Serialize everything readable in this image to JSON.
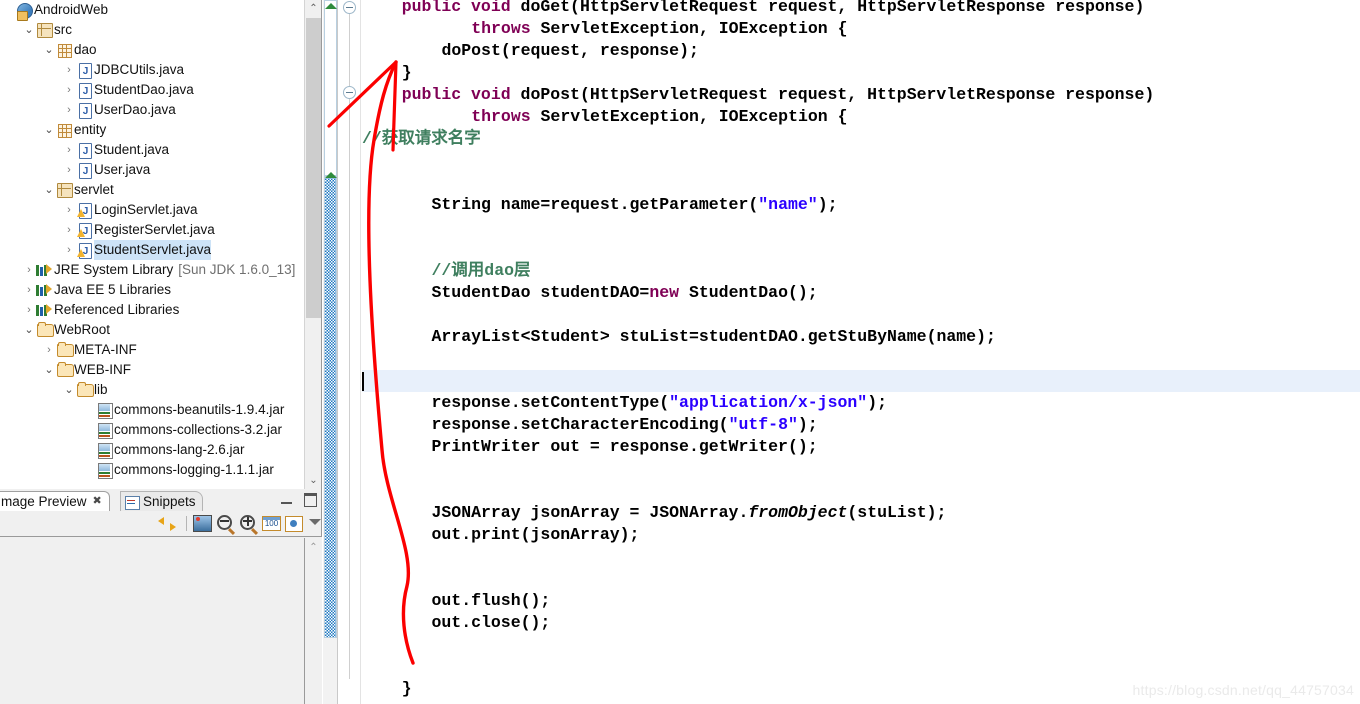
{
  "explorer": {
    "name": "package-explorer",
    "items": [
      {
        "label": "AndroidWeb",
        "suffix": "",
        "icon": "project-icon",
        "twist": "",
        "depth": 0,
        "selected": false
      },
      {
        "label": "src",
        "suffix": "",
        "icon": "source-folder-icon",
        "twist": "open",
        "depth": 1,
        "selected": false
      },
      {
        "label": "dao",
        "suffix": "",
        "icon": "package-icon",
        "twist": "open",
        "depth": 2,
        "selected": false
      },
      {
        "label": "JDBCUtils.java",
        "suffix": "",
        "icon": "java-file-icon",
        "twist": "closed",
        "depth": 3,
        "selected": false
      },
      {
        "label": "StudentDao.java",
        "suffix": "",
        "icon": "java-file-icon",
        "twist": "closed",
        "depth": 3,
        "selected": false
      },
      {
        "label": "UserDao.java",
        "suffix": "",
        "icon": "java-file-icon",
        "twist": "closed",
        "depth": 3,
        "selected": false
      },
      {
        "label": "entity",
        "suffix": "",
        "icon": "package-icon",
        "twist": "open",
        "depth": 2,
        "selected": false
      },
      {
        "label": "Student.java",
        "suffix": "",
        "icon": "java-file-icon",
        "twist": "closed",
        "depth": 3,
        "selected": false
      },
      {
        "label": "User.java",
        "suffix": "",
        "icon": "java-file-icon",
        "twist": "closed",
        "depth": 3,
        "selected": false
      },
      {
        "label": "servlet",
        "suffix": "",
        "icon": "source-folder-icon",
        "twist": "open",
        "depth": 2,
        "selected": false
      },
      {
        "label": "LoginServlet.java",
        "suffix": "",
        "icon": "java-file-warning-icon",
        "twist": "closed",
        "depth": 3,
        "selected": false
      },
      {
        "label": "RegisterServlet.java",
        "suffix": "",
        "icon": "java-file-warning-icon",
        "twist": "closed",
        "depth": 3,
        "selected": false
      },
      {
        "label": "StudentServlet.java",
        "suffix": "",
        "icon": "java-file-warning-icon",
        "twist": "closed",
        "depth": 3,
        "selected": true
      },
      {
        "label": "JRE System Library",
        "suffix": "[Sun JDK 1.6.0_13]",
        "icon": "library-icon",
        "twist": "closed",
        "depth": 1,
        "selected": false
      },
      {
        "label": "Java EE 5 Libraries",
        "suffix": "",
        "icon": "library-icon",
        "twist": "closed",
        "depth": 1,
        "selected": false
      },
      {
        "label": "Referenced Libraries",
        "suffix": "",
        "icon": "library-icon",
        "twist": "closed",
        "depth": 1,
        "selected": false
      },
      {
        "label": "WebRoot",
        "suffix": "",
        "icon": "folder-icon",
        "twist": "open",
        "depth": 1,
        "selected": false
      },
      {
        "label": "META-INF",
        "suffix": "",
        "icon": "folder-icon",
        "twist": "closed",
        "depth": 2,
        "selected": false
      },
      {
        "label": "WEB-INF",
        "suffix": "",
        "icon": "folder-icon",
        "twist": "open",
        "depth": 2,
        "selected": false
      },
      {
        "label": "lib",
        "suffix": "",
        "icon": "folder-icon",
        "twist": "open",
        "depth": 3,
        "selected": false
      },
      {
        "label": "commons-beanutils-1.9.4.jar",
        "suffix": "",
        "icon": "jar-icon",
        "twist": "",
        "depth": 4,
        "selected": false
      },
      {
        "label": "commons-collections-3.2.jar",
        "suffix": "",
        "icon": "jar-icon",
        "twist": "",
        "depth": 4,
        "selected": false
      },
      {
        "label": "commons-lang-2.6.jar",
        "suffix": "",
        "icon": "jar-icon",
        "twist": "",
        "depth": 4,
        "selected": false
      },
      {
        "label": "commons-logging-1.1.1.jar",
        "suffix": "",
        "icon": "jar-icon",
        "twist": "",
        "depth": 4,
        "selected": false
      }
    ],
    "scroll_up_glyph": "⌃",
    "scroll_down_glyph": "⌄"
  },
  "bottom_view": {
    "tabs": [
      {
        "label": "mage Preview",
        "active": true,
        "close_glyph": "✖"
      },
      {
        "label": "Snippets",
        "active": false
      }
    ],
    "toolbar": [
      {
        "name": "link-with-editor-icon"
      },
      {
        "name": "separator"
      },
      {
        "name": "show-image-icon"
      },
      {
        "name": "zoom-out-icon"
      },
      {
        "name": "zoom-in-icon"
      },
      {
        "name": "actual-size-icon",
        "label": "100"
      },
      {
        "name": "fit-to-window-icon"
      },
      {
        "name": "view-menu-icon"
      }
    ],
    "window_buttons": [
      {
        "name": "minimize-view-button"
      },
      {
        "name": "maximize-view-button"
      }
    ],
    "preview_scroll_glyph": "⌃"
  },
  "editor": {
    "name": "java-code-editor",
    "current_line_index": 17,
    "lines": [
      {
        "indent": 4,
        "segments": [
          {
            "t": "public ",
            "c": "kw"
          },
          {
            "t": "void ",
            "c": "kw"
          },
          {
            "t": "doGet(HttpServletRequest request, HttpServletResponse response)",
            "c": ""
          }
        ]
      },
      {
        "indent": 11,
        "segments": [
          {
            "t": "throws ",
            "c": "kw"
          },
          {
            "t": "ServletException, IOException {",
            "c": ""
          }
        ]
      },
      {
        "indent": 8,
        "segments": [
          {
            "t": "doPost(request, response);",
            "c": ""
          }
        ]
      },
      {
        "indent": 4,
        "segments": [
          {
            "t": "}",
            "c": ""
          }
        ]
      },
      {
        "indent": 4,
        "segments": [
          {
            "t": "public ",
            "c": "kw"
          },
          {
            "t": "void ",
            "c": "kw"
          },
          {
            "t": "doPost(HttpServletRequest request, HttpServletResponse response)",
            "c": ""
          }
        ]
      },
      {
        "indent": 11,
        "segments": [
          {
            "t": "throws ",
            "c": "kw"
          },
          {
            "t": "ServletException, IOException {",
            "c": ""
          }
        ]
      },
      {
        "indent": 0,
        "segments": [
          {
            "t": "//获取请求名字",
            "c": "cmt"
          }
        ]
      },
      {
        "indent": 0,
        "segments": []
      },
      {
        "indent": 0,
        "segments": []
      },
      {
        "indent": 7,
        "segments": [
          {
            "t": "String name=request.getParameter(",
            "c": ""
          },
          {
            "t": "\"name\"",
            "c": "str"
          },
          {
            "t": ");",
            "c": ""
          }
        ]
      },
      {
        "indent": 0,
        "segments": []
      },
      {
        "indent": 0,
        "segments": []
      },
      {
        "indent": 7,
        "segments": [
          {
            "t": "//调用dao层",
            "c": "cmt"
          }
        ]
      },
      {
        "indent": 7,
        "segments": [
          {
            "t": "StudentDao studentDAO=",
            "c": ""
          },
          {
            "t": "new",
            "c": "kw"
          },
          {
            "t": " StudentDao();",
            "c": ""
          }
        ]
      },
      {
        "indent": 0,
        "segments": []
      },
      {
        "indent": 7,
        "segments": [
          {
            "t": "ArrayList<Student> stuList=studentDAO.getStuByName(name);",
            "c": ""
          }
        ]
      },
      {
        "indent": 0,
        "segments": []
      },
      {
        "indent": 0,
        "segments": []
      },
      {
        "indent": 7,
        "segments": [
          {
            "t": "response.setContentType(",
            "c": ""
          },
          {
            "t": "\"application/x-json\"",
            "c": "str"
          },
          {
            "t": ");",
            "c": ""
          }
        ]
      },
      {
        "indent": 7,
        "segments": [
          {
            "t": "response.setCharacterEncoding(",
            "c": ""
          },
          {
            "t": "\"utf-8\"",
            "c": "str"
          },
          {
            "t": ");",
            "c": ""
          }
        ]
      },
      {
        "indent": 7,
        "segments": [
          {
            "t": "PrintWriter out = response.getWriter();",
            "c": ""
          }
        ]
      },
      {
        "indent": 7,
        "segments": []
      },
      {
        "indent": 0,
        "segments": []
      },
      {
        "indent": 7,
        "segments": [
          {
            "t": "JSONArray jsonArray = JSONArray.",
            "c": ""
          },
          {
            "t": "fromObject",
            "c": "sm"
          },
          {
            "t": "(stuList);",
            "c": ""
          }
        ]
      },
      {
        "indent": 7,
        "segments": [
          {
            "t": "out.print(jsonArray);",
            "c": ""
          }
        ]
      },
      {
        "indent": 0,
        "segments": []
      },
      {
        "indent": 0,
        "segments": []
      },
      {
        "indent": 7,
        "segments": [
          {
            "t": "out.flush();",
            "c": ""
          }
        ]
      },
      {
        "indent": 7,
        "segments": [
          {
            "t": "out.close();",
            "c": ""
          }
        ]
      },
      {
        "indent": 0,
        "segments": []
      },
      {
        "indent": 0,
        "segments": []
      },
      {
        "indent": 4,
        "segments": [
          {
            "t": "}",
            "c": ""
          }
        ]
      }
    ],
    "colors": {
      "keyword": "#7f0055",
      "string": "#2a00ff",
      "comment": "#3f7f5f",
      "current_line": "#e8f0fb",
      "annotation_arrow": "#fb0000"
    }
  },
  "watermark": {
    "text": "https://blog.csdn.net/qq_44757034"
  }
}
